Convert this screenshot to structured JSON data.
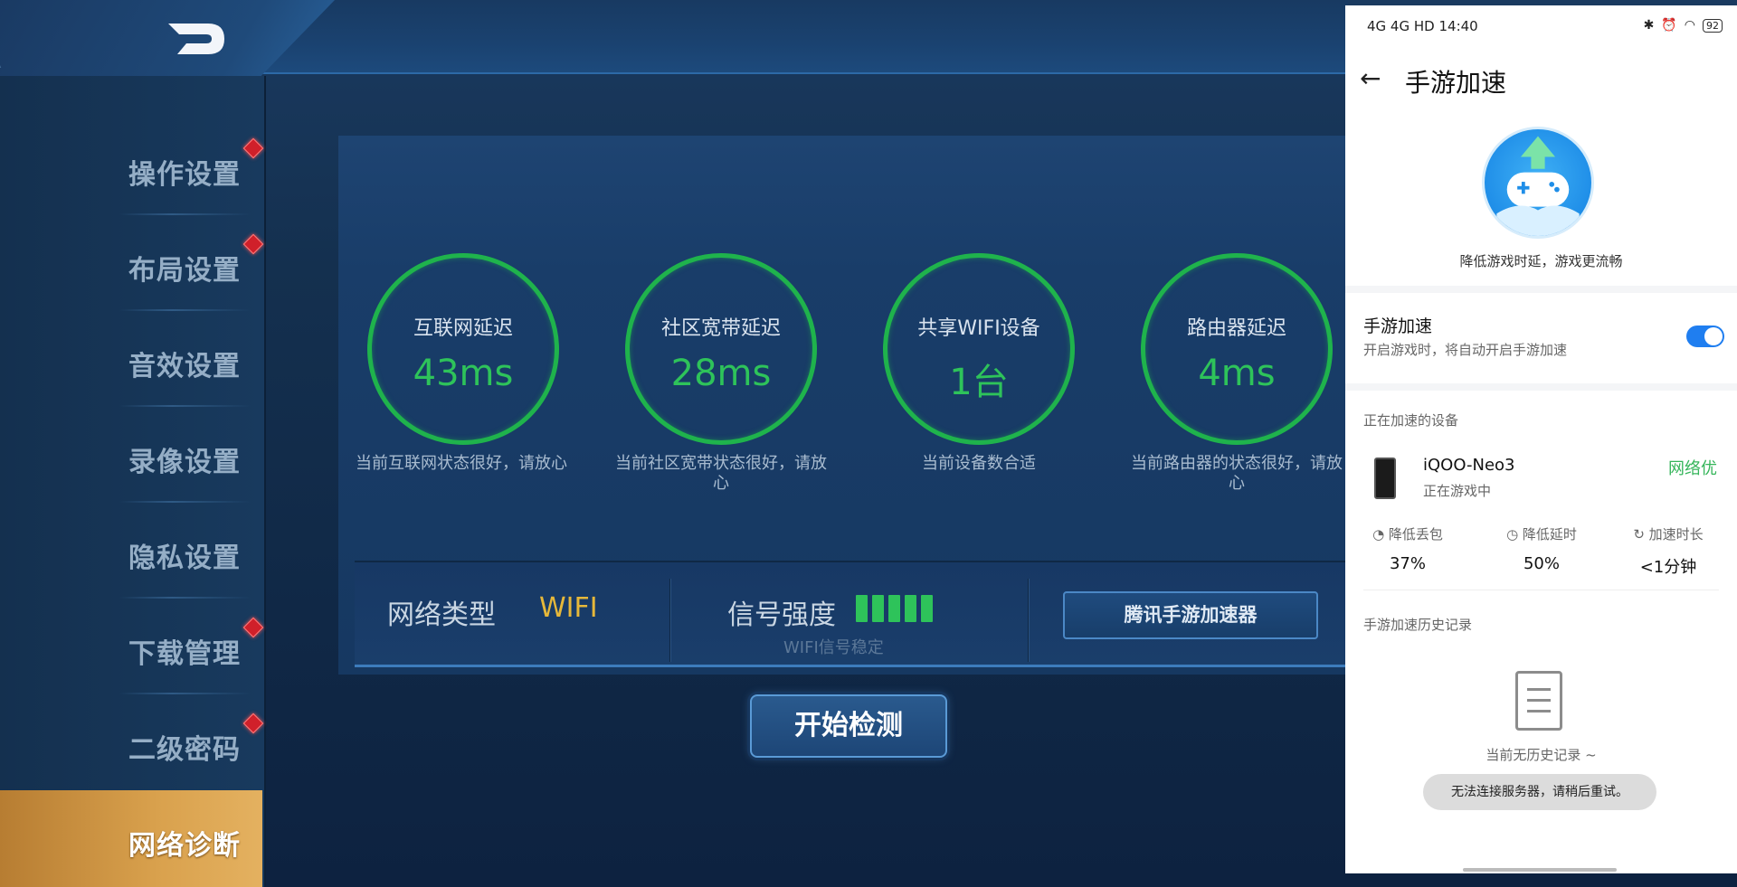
{
  "game": {
    "sidebar": {
      "items": [
        {
          "label": "操作设置",
          "dot": true,
          "active": false
        },
        {
          "label": "布局设置",
          "dot": true,
          "active": false
        },
        {
          "label": "音效设置",
          "dot": false,
          "active": false
        },
        {
          "label": "录像设置",
          "dot": false,
          "active": false
        },
        {
          "label": "隐私设置",
          "dot": false,
          "active": false
        },
        {
          "label": "下载管理",
          "dot": true,
          "active": false
        },
        {
          "label": "二级密码",
          "dot": true,
          "active": false
        },
        {
          "label": "网络诊断",
          "dot": false,
          "active": true
        }
      ]
    },
    "gauges": [
      {
        "title": "互联网延迟",
        "value": "43ms",
        "desc": "当前互联网状态很好，请放心"
      },
      {
        "title": "社区宽带延迟",
        "value": "28ms",
        "desc": "当前社区宽带状态很好，请放心"
      },
      {
        "title": "共享WIFI设备",
        "value": "1台",
        "desc": "当前设备数合适"
      },
      {
        "title": "路由器延迟",
        "value": "4ms",
        "desc": "当前路由器的状态很好，请放心"
      }
    ],
    "network_type_label": "网络类型",
    "network_type_value": "WIFI",
    "signal_label": "信号强度",
    "signal_bars": 5,
    "signal_sub": "WIFI信号稳定",
    "tencent_button": "腾讯手游加速器",
    "start_button": "开始检测",
    "colors": {
      "accent_green": "#2ec35a",
      "wifi_yellow": "#e6b83a",
      "active_gold": "#d9a14d"
    }
  },
  "phone": {
    "status_time": "14:40",
    "status_left": "4G 4G HD",
    "battery": "92",
    "title": "手游加速",
    "tagline": "降低游戏时延，游戏更流畅",
    "toggle": {
      "title": "手游加速",
      "subtitle": "开启游戏时，将自动开启手游加速",
      "on": true
    },
    "devices_label": "正在加速的设备",
    "device": {
      "name": "iQOO-Neo3",
      "status": "正在游戏中",
      "quality": "网络优"
    },
    "stats": [
      {
        "icon": "chart-icon",
        "label": "降低丢包",
        "value": "37%"
      },
      {
        "icon": "clock-icon",
        "label": "降低延时",
        "value": "50%"
      },
      {
        "icon": "timer-icon",
        "label": "加速时长",
        "value": "<1分钟"
      }
    ],
    "history_label": "手游加速历史记录",
    "empty_text": "当前无历史记录 ~",
    "toast": "无法连接服务器，请稍后重试。",
    "colors": {
      "switch_blue": "#1f7ef0",
      "quality_green": "#35b55a"
    }
  }
}
